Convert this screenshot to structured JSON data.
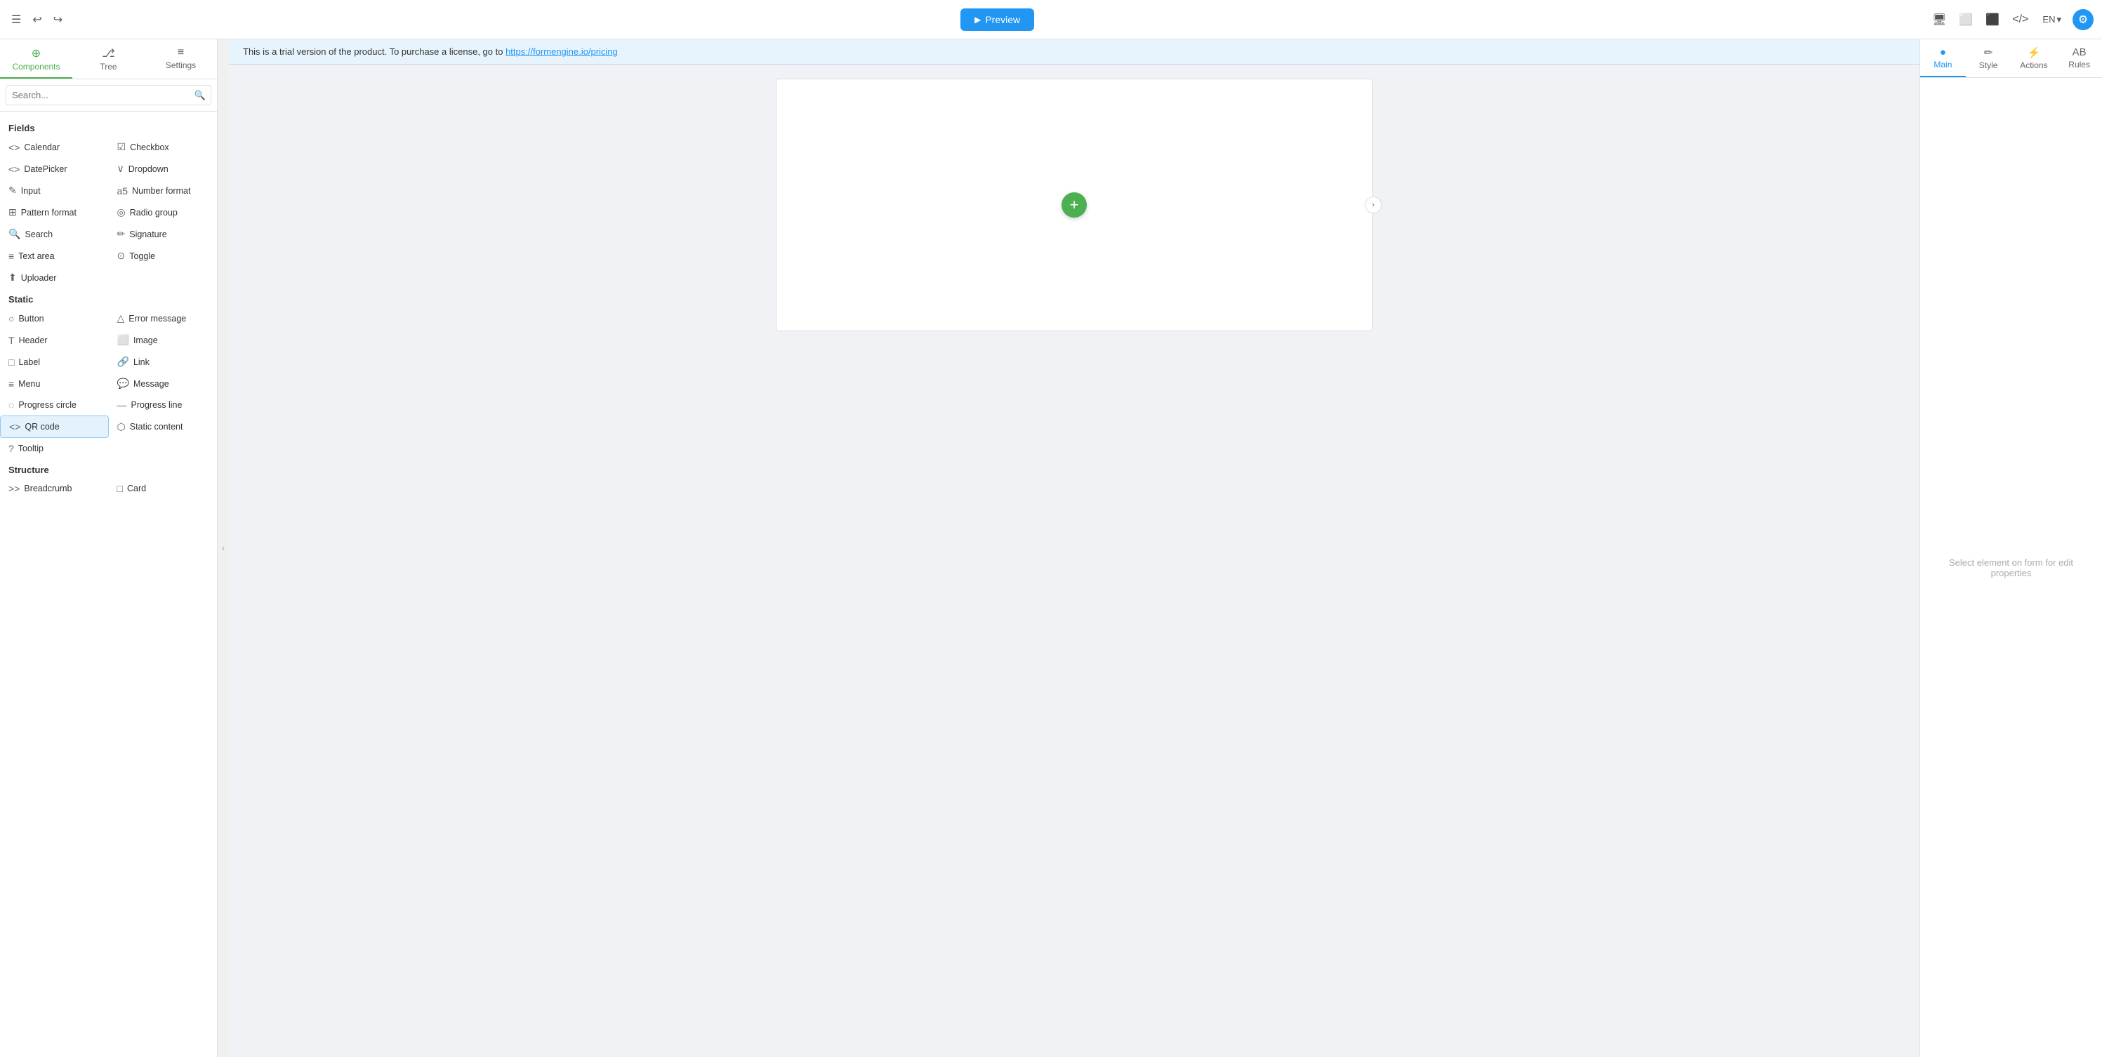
{
  "topbar": {
    "menu_icon": "☰",
    "undo_icon": "↩",
    "redo_icon": "↪",
    "preview_label": "Preview",
    "desktop_icon": "🖥",
    "tablet_icon": "⬜",
    "mobile_icon": "⬛",
    "code_icon": "</>",
    "lang": "EN",
    "lang_chevron": "▾",
    "settings_icon": "⚙"
  },
  "sidebar": {
    "tabs": [
      {
        "id": "components",
        "label": "Components",
        "icon": "⊕",
        "active": true
      },
      {
        "id": "tree",
        "label": "Tree",
        "icon": "⎇",
        "active": false
      },
      {
        "id": "settings",
        "label": "Settings",
        "icon": "≡",
        "active": false
      }
    ],
    "search_placeholder": "Search...",
    "sections": [
      {
        "label": "Fields",
        "items": [
          {
            "id": "calendar",
            "label": "Calendar",
            "icon": "<>"
          },
          {
            "id": "checkbox",
            "label": "Checkbox",
            "icon": "☑"
          },
          {
            "id": "datepicker",
            "label": "DatePicker",
            "icon": "<>"
          },
          {
            "id": "dropdown",
            "label": "Dropdown",
            "icon": "∨"
          },
          {
            "id": "input",
            "label": "Input",
            "icon": "✎"
          },
          {
            "id": "number-format",
            "label": "Number format",
            "icon": "а5"
          },
          {
            "id": "pattern-format",
            "label": "Pattern format",
            "icon": "⊞"
          },
          {
            "id": "radio-group",
            "label": "Radio group",
            "icon": "◎"
          },
          {
            "id": "search",
            "label": "Search",
            "icon": "🔍"
          },
          {
            "id": "signature",
            "label": "Signature",
            "icon": "✏"
          },
          {
            "id": "text-area",
            "label": "Text area",
            "icon": "≡"
          },
          {
            "id": "toggle",
            "label": "Toggle",
            "icon": "⊙"
          },
          {
            "id": "uploader",
            "label": "Uploader",
            "icon": "⬆"
          }
        ]
      },
      {
        "label": "Static",
        "items": [
          {
            "id": "button",
            "label": "Button",
            "icon": "○"
          },
          {
            "id": "error-message",
            "label": "Error message",
            "icon": "△"
          },
          {
            "id": "header",
            "label": "Header",
            "icon": "T"
          },
          {
            "id": "image",
            "label": "Image",
            "icon": "⬜"
          },
          {
            "id": "label",
            "label": "Label",
            "icon": "□"
          },
          {
            "id": "link",
            "label": "Link",
            "icon": "🔗"
          },
          {
            "id": "menu",
            "label": "Menu",
            "icon": "≡"
          },
          {
            "id": "message",
            "label": "Message",
            "icon": "💬"
          },
          {
            "id": "progress-circle",
            "label": "Progress circle",
            "icon": "◌"
          },
          {
            "id": "progress-line",
            "label": "Progress line",
            "icon": "—"
          },
          {
            "id": "qr-code",
            "label": "QR code",
            "icon": "<>",
            "selected": true
          },
          {
            "id": "static-content",
            "label": "Static content",
            "icon": "⬡"
          },
          {
            "id": "tooltip",
            "label": "Tooltip",
            "icon": "?"
          }
        ]
      },
      {
        "label": "Structure",
        "items": [
          {
            "id": "breadcrumb",
            "label": "Breadcrumb",
            "icon": ">>"
          },
          {
            "id": "card",
            "label": "Card",
            "icon": "□"
          }
        ]
      }
    ]
  },
  "trial_banner": {
    "text": "This is a trial version of the product. To purchase a license, go to ",
    "link_text": "https://formengine.io/pricing",
    "link_url": "https://formengine.io/pricing"
  },
  "canvas": {
    "add_button_label": "+"
  },
  "right_panel": {
    "tabs": [
      {
        "id": "main",
        "label": "Main",
        "icon": "●",
        "active": true
      },
      {
        "id": "style",
        "label": "Style",
        "icon": "✏"
      },
      {
        "id": "actions",
        "label": "Actions",
        "icon": "⚡"
      },
      {
        "id": "rules",
        "label": "Rules",
        "icon": "AB"
      }
    ],
    "hint": "Select element on form for edit properties"
  }
}
